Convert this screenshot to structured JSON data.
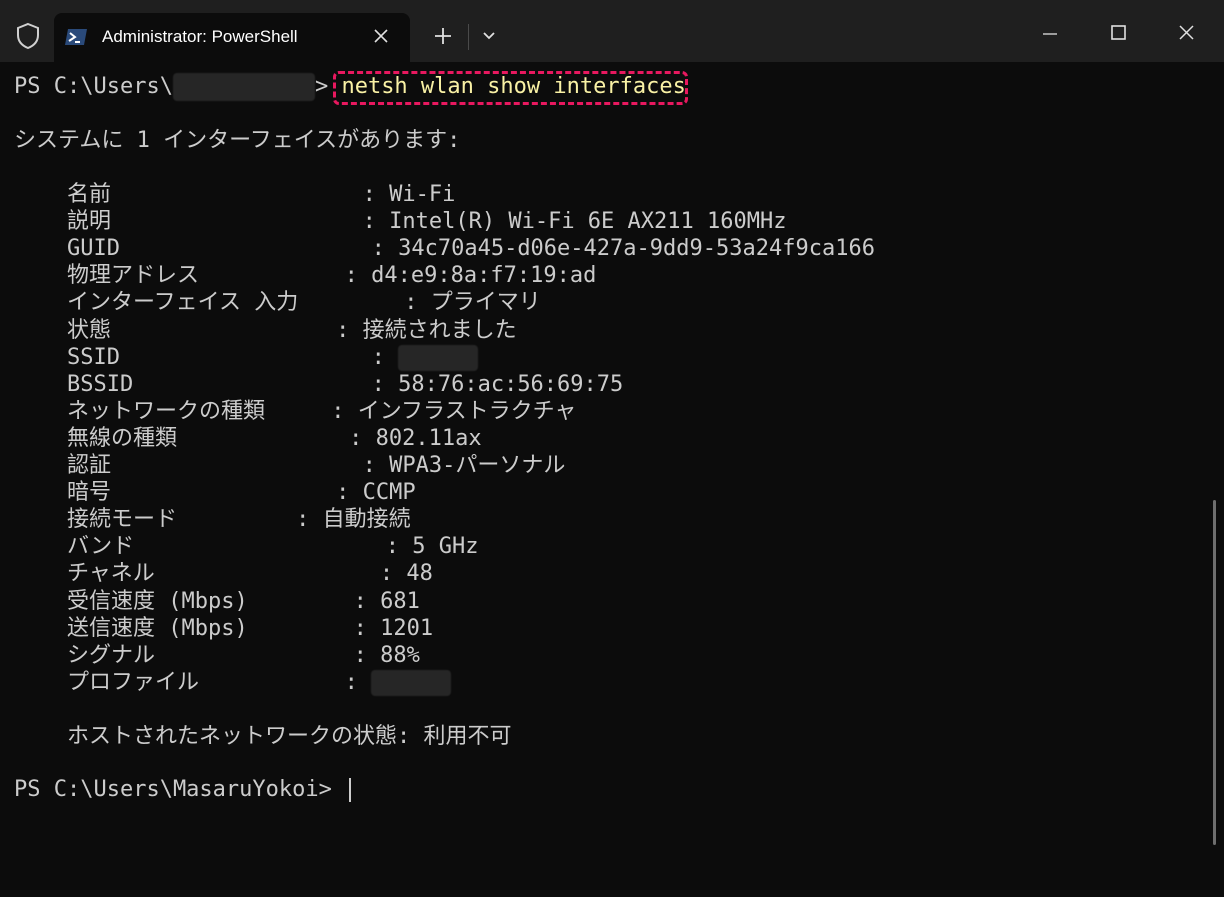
{
  "window": {
    "tab_title": "Administrator: PowerShell"
  },
  "icons": {
    "shield": "shield-icon",
    "powershell": "powershell-icon",
    "tab_close": "close-icon",
    "new_tab": "plus-icon",
    "dropdown": "chevron-down-icon",
    "minimize": "minimize-icon",
    "maximize": "maximize-icon",
    "close_window": "close-icon"
  },
  "colors": {
    "background": "#0c0c0c",
    "titlebar": "#1f1f1f",
    "text": "#cccccc",
    "command": "#f9f1a5",
    "highlight_border": "#e8185f"
  },
  "console": {
    "prompt1_prefix": "PS C:\\Users\\",
    "prompt1_suffix": "> ",
    "command": "netsh wlan show interfaces",
    "summary": "システムに 1 インターフェイスがあります:",
    "rows": [
      "    名前                   : Wi-Fi",
      "    説明                   : Intel(R) Wi-Fi 6E AX211 160MHz",
      "    GUID                   : 34c70a45-d06e-427a-9dd9-53a24f9ca166",
      "    物理アドレス           : d4:e9:8a:f7:19:ad",
      "    インターフェイス 入力        : プライマリ",
      "    状態                 : 接続されました",
      "    SSID                   : ",
      "    BSSID                  : 58:76:ac:56:69:75",
      "    ネットワークの種類     : インフラストラクチャ",
      "    無線の種類             : 802.11ax",
      "    認証                   : WPA3-パーソナル",
      "    暗号                 : CCMP",
      "    接続モード         : 自動接続",
      "    バンド                   : 5 GHz",
      "    チャネル                 : 48",
      "    受信速度 (Mbps)        : 681",
      "    送信速度 (Mbps)        : 1201",
      "    シグナル               : 88%",
      "    プロファイル           : ",
      "",
      "    ホストされたネットワークの状態: 利用不可"
    ],
    "prompt2": "PS C:\\Users\\MasaruYokoi> "
  }
}
